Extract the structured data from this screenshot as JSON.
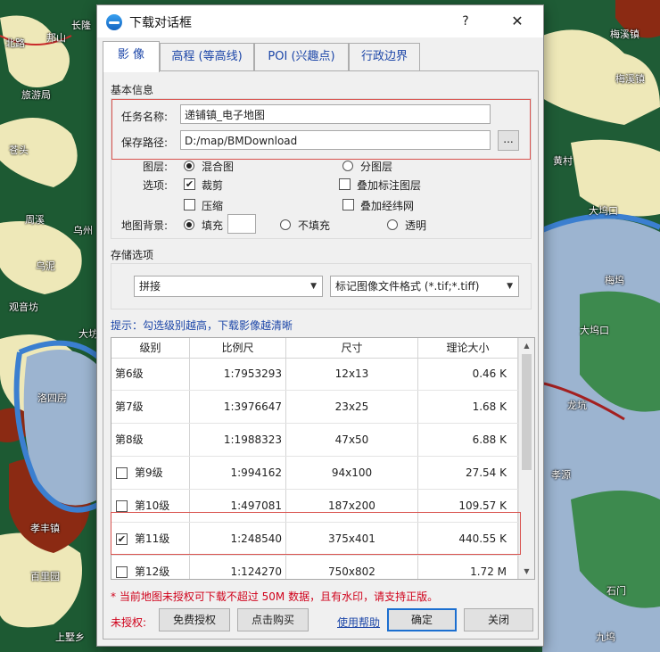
{
  "map": {
    "labels": [
      "长隆",
      "邦山",
      "梅溪镇",
      "梅溪镇",
      "北路",
      "旅游局",
      "黄村",
      "苍头",
      "周溪",
      "乌州",
      "乌泥",
      "观音坊",
      "大坊",
      "洛四房",
      "孝丰镇",
      "百里园",
      "上墅乡",
      "大坞口",
      "大坞口",
      "梅坞",
      "龙坑",
      "石门",
      "孝源",
      "九坞"
    ]
  },
  "dialog": {
    "title": "下载对话框",
    "help_label": "?",
    "close_label": "✕",
    "tabs": [
      "影 像",
      "高程 (等高线)",
      "POI (兴趣点)",
      "行政边界"
    ],
    "basic_info": {
      "section_label": "基本信息",
      "task_name_label": "任务名称:",
      "task_name_value": "递铺镇_电子地图",
      "save_path_label": "保存路径:",
      "save_path_value": "D:/map/BMDownload",
      "browse_label": "...",
      "layer_label": "图层:",
      "layer_mixed": "混合图",
      "layer_split": "分图层",
      "options_label": "选项:",
      "opt_crop": "裁剪",
      "opt_compress": "压缩",
      "opt_overlay_labels": "叠加标注图层",
      "opt_overlay_grid": "叠加经纬网",
      "bg_label": "地图背景:",
      "bg_fill": "填充",
      "bg_nofill": "不填充",
      "bg_transparent": "透明"
    },
    "storage": {
      "section_label": "存储选项",
      "mode_value": "拼接",
      "format_value": "标记图像文件格式 (*.tif;*.tiff)"
    },
    "hint": "提示：勾选级别越高，下载影像越清晰",
    "table": {
      "headers": [
        "级别",
        "比例尺",
        "尺寸",
        "理论大小"
      ],
      "rows": [
        {
          "level": "第6级",
          "scale": "1:7953293",
          "size": "12x13",
          "est": "0.46 K",
          "checkbox": false,
          "checked": false
        },
        {
          "level": "第7级",
          "scale": "1:3976647",
          "size": "23x25",
          "est": "1.68 K",
          "checkbox": false,
          "checked": false
        },
        {
          "level": "第8级",
          "scale": "1:1988323",
          "size": "47x50",
          "est": "6.88 K",
          "checkbox": false,
          "checked": false
        },
        {
          "level": "第9级",
          "scale": "1:994162",
          "size": "94x100",
          "est": "27.54 K",
          "checkbox": true,
          "checked": false
        },
        {
          "level": "第10级",
          "scale": "1:497081",
          "size": "187x200",
          "est": "109.57 K",
          "checkbox": true,
          "checked": false
        },
        {
          "level": "第11级",
          "scale": "1:248540",
          "size": "375x401",
          "est": "440.55 K",
          "checkbox": true,
          "checked": true
        },
        {
          "level": "第12级",
          "scale": "1:124270",
          "size": "750x802",
          "est": "1.72 M",
          "checkbox": true,
          "checked": false
        }
      ]
    },
    "warning": "* 当前地图未授权可下载不超过 50M 数据，且有水印，请支持正版。",
    "footer": {
      "unauthorized_label": "未授权:",
      "free_auth_label": "免费授权",
      "buy_label": "点击购买",
      "help_link": "使用帮助",
      "ok_label": "确定",
      "close_label": "关闭"
    },
    "colors": {
      "accent": "#1c46a8",
      "warning": "#d0021b",
      "highlight_box": "#d9534f"
    }
  }
}
